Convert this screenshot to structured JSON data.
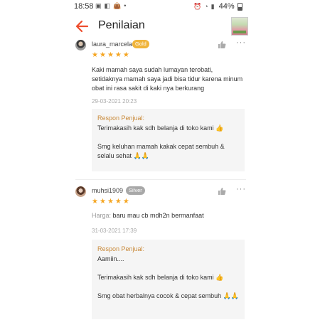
{
  "status_bar": {
    "time": "18:58",
    "battery_text": "44%",
    "left_icons": [
      "image-icon",
      "sim-icon",
      "bag-icon"
    ],
    "right_icons": [
      "alarm-icon",
      "wifi-icon",
      "signal-icon"
    ]
  },
  "app_bar": {
    "title": "Penilaian",
    "back_icon": "arrow-left-icon",
    "accent_color": "#ee4d2d"
  },
  "reviews": [
    {
      "username": "laura_marcela",
      "badge": "Gold",
      "rating": 5,
      "text": "Kaki mamah saya sudah lumayan terobati, setidaknya mamah saya jadi bisa tidur karena minum obat ini rasa sakit di kaki nya berkurang",
      "date": "29-03-2021 20:23",
      "seller_label": "Respon Penjual:",
      "seller_response": "Terimakasih kak sdh belanja di toko kami 👍\n\nSmg keluhan mamah kakak cepat sembuh & selalu sehat 🙏🙏"
    },
    {
      "username": "muhsi1909",
      "badge": "Silver",
      "rating": 5,
      "harga_label": "Harga:",
      "harga_value": "baru mau cb mdh2n bermanfaat",
      "date": "31-03-2021 17:39",
      "seller_label": "Respon Penjual:",
      "seller_response": "Aamiin....\n\nTerimakasih kak sdh belanja di toko kami 👍\n\nSmg obat herbalnya cocok & cepat sembuh 🙏🙏"
    }
  ]
}
